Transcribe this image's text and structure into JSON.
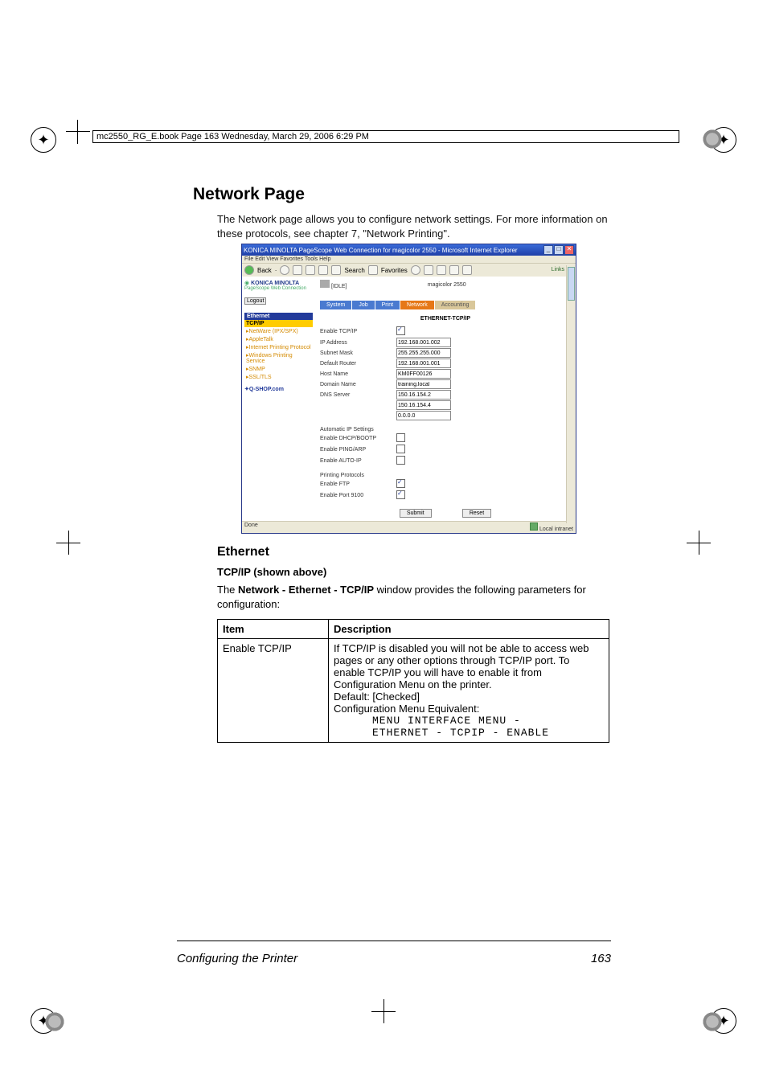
{
  "header_text": "mc2550_RG_E.book  Page 163  Wednesday, March 29, 2006  6:29 PM",
  "h1": "Network Page",
  "intro_before": "The Network page allows you to configure network settings. For more information on these protocols, see chapter 7, \"Network Printing\".",
  "ie": {
    "title": "KONICA MINOLTA PageScope Web Connection for magicolor 2550 - Microsoft Internet Explorer",
    "menus": "File   Edit   View   Favorites   Tools   Help",
    "back": "Back",
    "search": "Search",
    "favorites": "Favorites",
    "links": "Links",
    "brand1": "KONICA MINOLTA",
    "brand2": "PageScope Web Connection",
    "logout": "Logout",
    "printer_status": "[IDLE]",
    "printer_name": "magicolor 2550",
    "tabs": [
      "System",
      "Job",
      "Print",
      "Network",
      "Accounting"
    ],
    "side_header": "Ethernet",
    "side_items": [
      "TCP/IP",
      "NetWare (IPX/SPX)",
      "AppleTalk",
      "Internet Printing Protocol",
      "Windows Printing Service",
      "SNMP",
      "SSL/TLS"
    ],
    "shop": "Q-SHOP.com",
    "form_title": "ETHERNET-TCP/IP",
    "rows": [
      {
        "label": "Enable TCP/IP",
        "type": "check",
        "checked": true
      },
      {
        "label": "IP Address",
        "type": "text",
        "value": "192.168.001.002"
      },
      {
        "label": "Subnet Mask",
        "type": "text",
        "value": "255.255.255.000"
      },
      {
        "label": "Default Router",
        "type": "text",
        "value": "192.168.001.001"
      },
      {
        "label": "Host Name",
        "type": "text",
        "value": "KM0FF00126"
      },
      {
        "label": "Domain Name",
        "type": "text",
        "value": "training.local"
      },
      {
        "label": "DNS Server",
        "type": "text",
        "value": "150.16.154.2"
      },
      {
        "label": "",
        "type": "text",
        "value": "150.16.154.4"
      },
      {
        "label": "",
        "type": "text",
        "value": "0.0.0.0"
      }
    ],
    "group_auto": "Automatic IP Settings",
    "rows2": [
      {
        "label": "Enable DHCP/BOOTP",
        "type": "check",
        "checked": false
      },
      {
        "label": "Enable PING/ARP",
        "type": "check",
        "checked": false
      },
      {
        "label": "Enable AUTO-IP",
        "type": "check",
        "checked": false
      }
    ],
    "group_pp": "Printing Protocols",
    "rows3": [
      {
        "label": "Enable FTP",
        "type": "check",
        "checked": true
      },
      {
        "label": "Enable Port 9100",
        "type": "check",
        "checked": true
      }
    ],
    "submit": "Submit",
    "reset": "Reset",
    "status_done": "Done",
    "status_zone": "Local intranet"
  },
  "h2": "Ethernet",
  "h3": "TCP/IP (shown above)",
  "para_before_bold": "The ",
  "para_bold": "Network - Ethernet - TCP/IP",
  "para_after_bold": " window provides the following parameters for configuration:",
  "table": {
    "head_item": "Item",
    "head_desc": "Description",
    "row1_item": "Enable TCP/IP",
    "row1_desc_l1": "If TCP/IP is disabled you will not be able to access web pages or any other options through TCP/IP port. To enable TCP/IP you will have to enable it from Configuration Menu on the printer.",
    "row1_desc_l2": "Default: [Checked]",
    "row1_desc_l3": "Configuration Menu Equivalent:",
    "row1_mono1": "MENU INTERFACE MENU -",
    "row1_mono2": "ETHERNET - TCPIP - ENABLE"
  },
  "footer_title": "Configuring the Printer",
  "footer_page": "163"
}
